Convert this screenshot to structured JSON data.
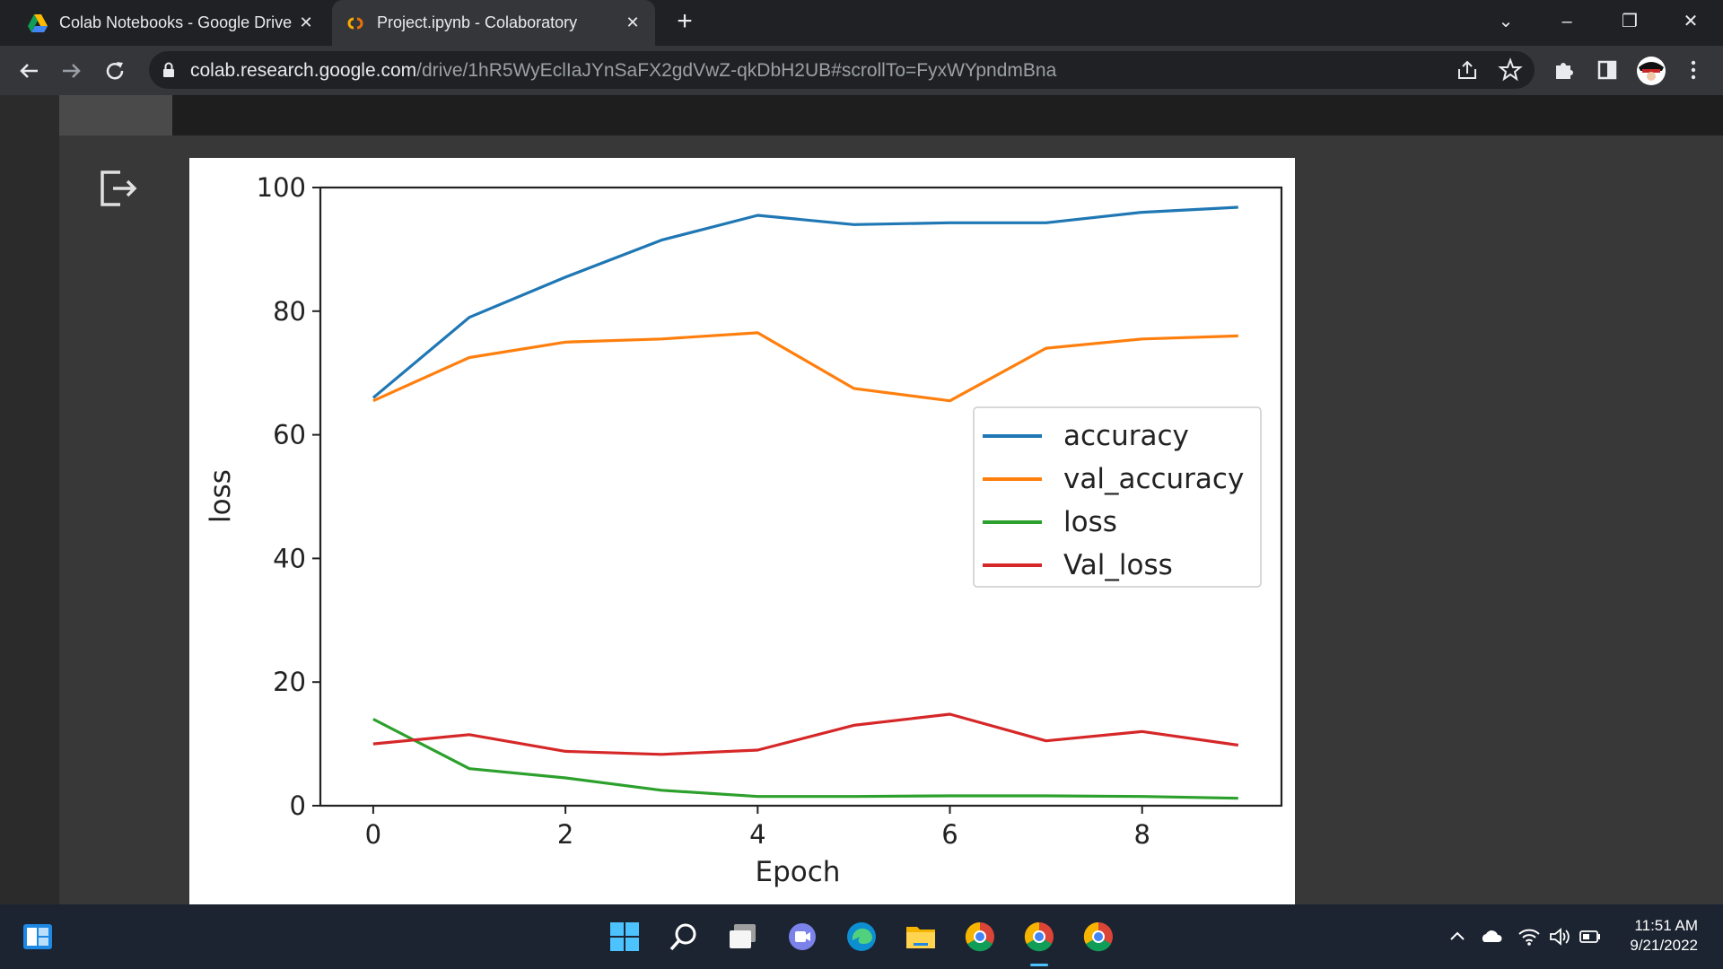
{
  "browser": {
    "tabs": [
      {
        "title": "Colab Notebooks - Google Drive",
        "active": false,
        "icon": "google-drive-icon"
      },
      {
        "title": "Project.ipynb - Colaboratory",
        "active": true,
        "icon": "colab-icon"
      }
    ],
    "url": {
      "host": "colab.research.google.com",
      "path": "/drive/1hR5WyEclIaJYnSaFX2gdVwZ-qkDbH2UB#scrollTo=FyxWYpndmBna"
    }
  },
  "colors": {
    "accuracy": "#1f77b4",
    "val_accuracy": "#ff7f0e",
    "loss": "#2ca02c",
    "val_loss": "#d62728"
  },
  "chart_data": {
    "type": "line",
    "title": "",
    "xlabel": "Epoch",
    "ylabel": "loss",
    "x": [
      0,
      1,
      2,
      3,
      4,
      5,
      6,
      7,
      8,
      9
    ],
    "xlim": [
      -0.55,
      9.45
    ],
    "ylim": [
      0,
      100
    ],
    "xticks": [
      0,
      2,
      4,
      6,
      8
    ],
    "yticks": [
      0,
      20,
      40,
      60,
      80,
      100
    ],
    "grid": false,
    "legend_position": "center-right",
    "series": [
      {
        "name": "accuracy",
        "color": "#1f77b4",
        "values": [
          66,
          79,
          85.5,
          91.5,
          95.5,
          94,
          94.3,
          94.3,
          96,
          96.8
        ]
      },
      {
        "name": "val_accuracy",
        "color": "#ff7f0e",
        "values": [
          65.5,
          72.5,
          75,
          75.5,
          76.5,
          67.5,
          65.5,
          74,
          75.5,
          76
        ]
      },
      {
        "name": "loss",
        "color": "#2ca02c",
        "values": [
          14,
          6,
          4.5,
          2.5,
          1.5,
          1.5,
          1.6,
          1.6,
          1.5,
          1.2
        ]
      },
      {
        "name": "Val_loss",
        "color": "#d62728",
        "values": [
          10,
          11.5,
          8.8,
          8.3,
          9,
          13,
          14.8,
          10.5,
          12,
          9.8
        ]
      }
    ]
  },
  "taskbar": {
    "time": "11:51 AM",
    "date": "9/21/2022",
    "apps": [
      "windows-start-icon",
      "search-icon",
      "task-view-icon",
      "teams-chat-icon",
      "edge-icon",
      "file-explorer-icon",
      "chrome-icon",
      "chrome-icon",
      "chrome-icon"
    ]
  }
}
